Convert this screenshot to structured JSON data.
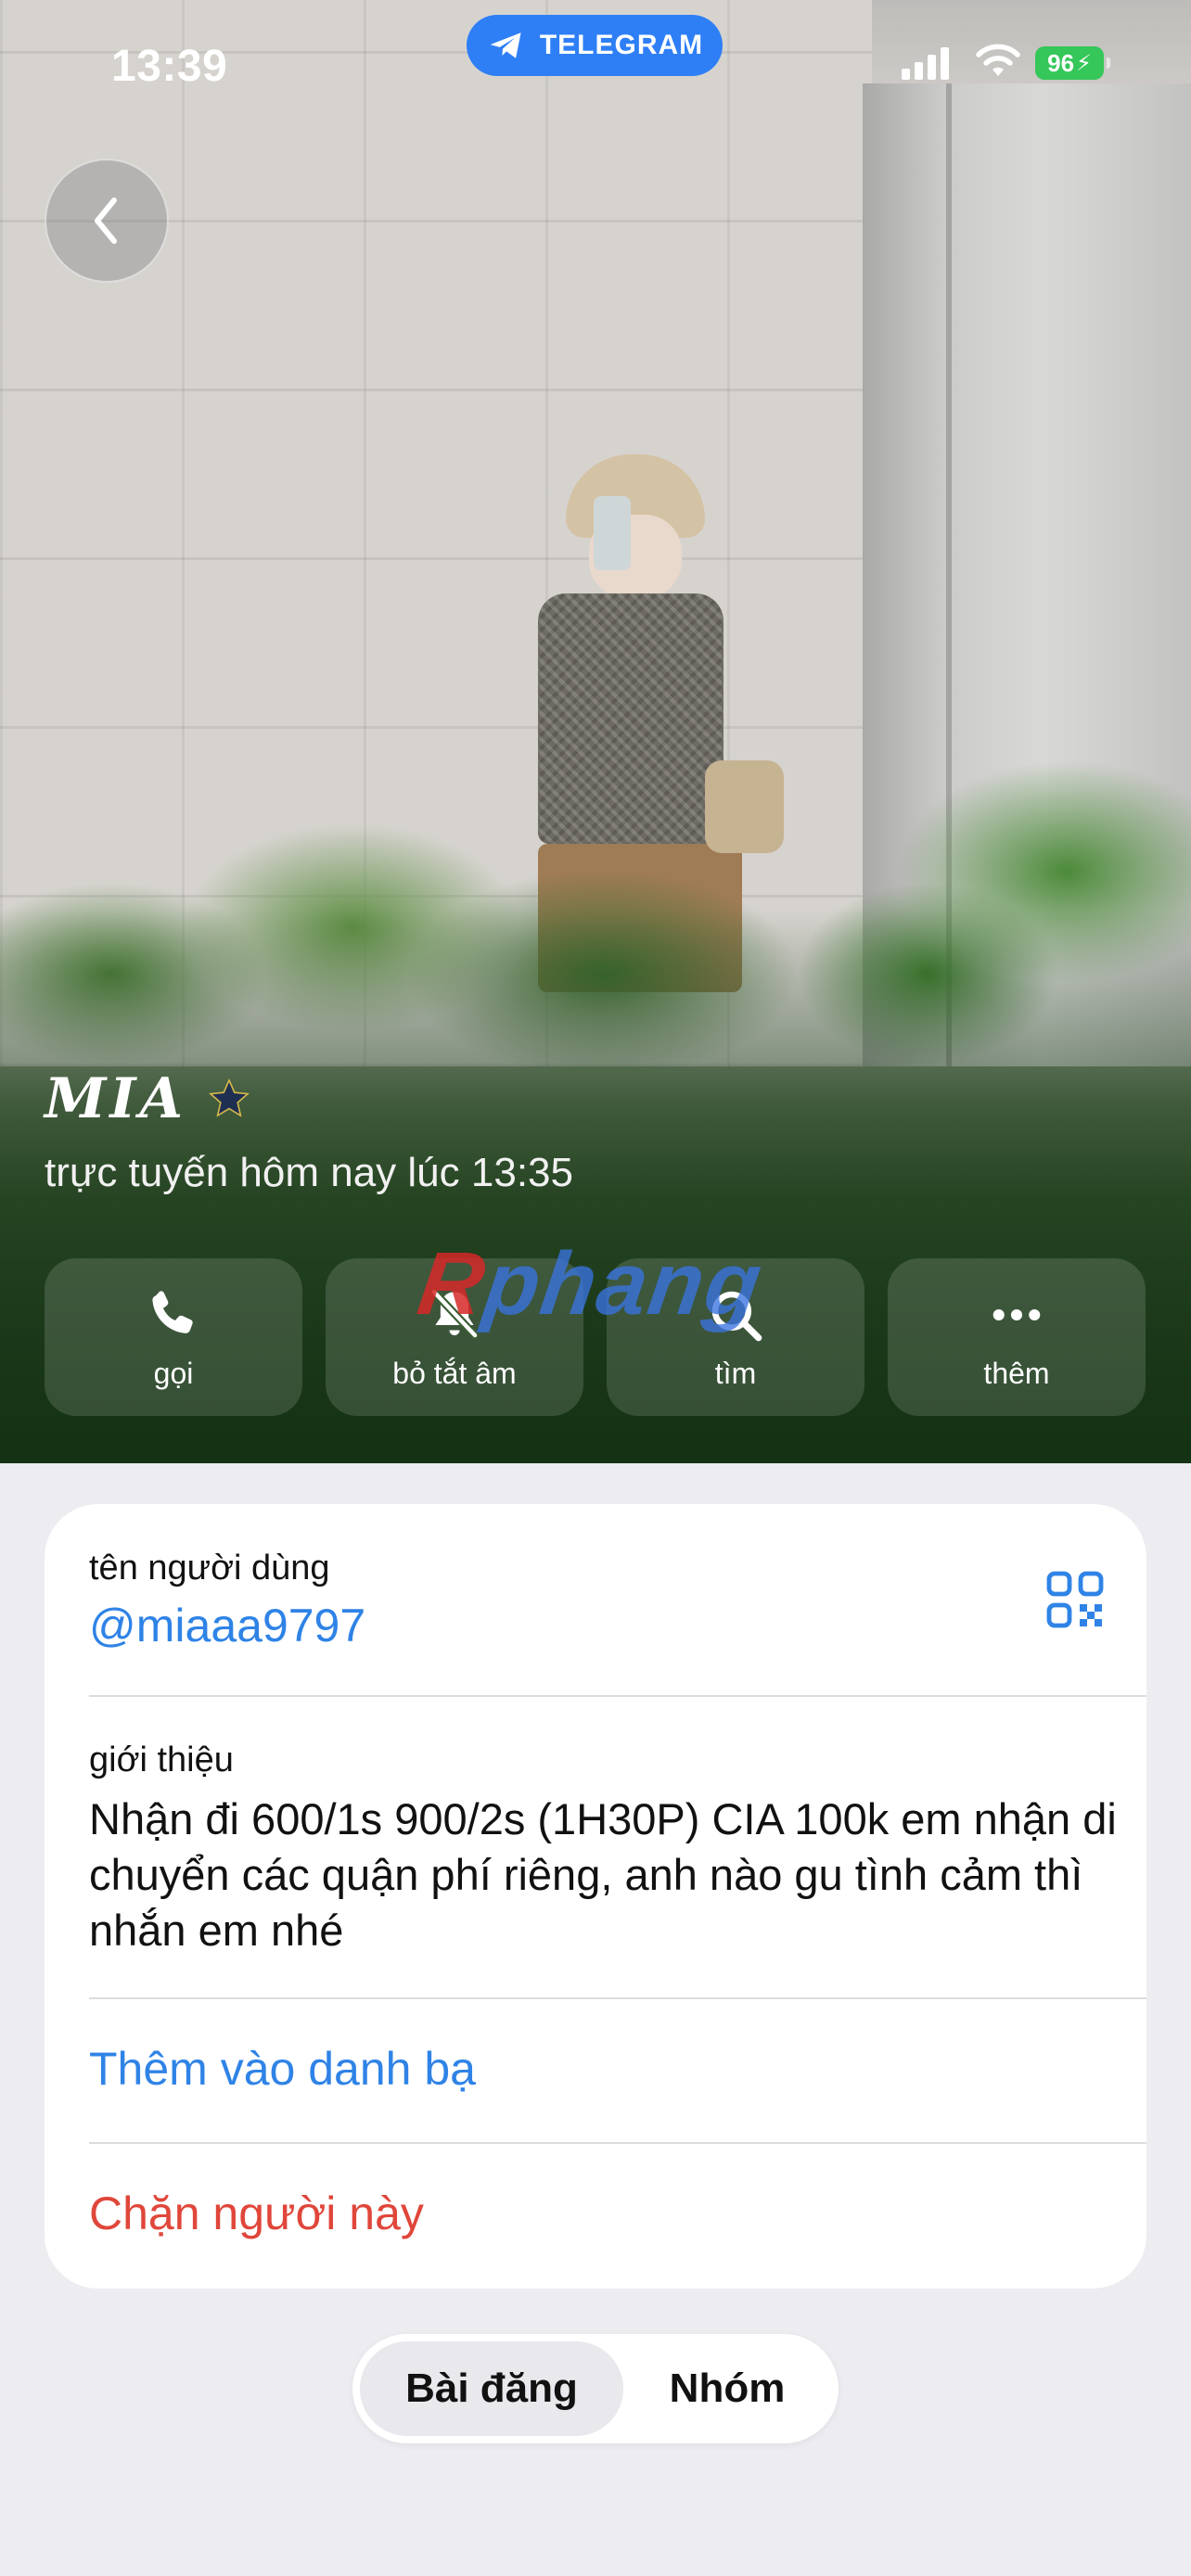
{
  "status_bar": {
    "time": "13:39",
    "app_pill": "TELEGRAM",
    "battery": "96"
  },
  "profile": {
    "name": "MIA",
    "last_seen": "trực tuyến hôm nay lúc 13:35"
  },
  "actions": [
    {
      "label": "gọi",
      "icon": "phone-icon"
    },
    {
      "label": "bỏ tắt âm",
      "icon": "bell-slash-icon"
    },
    {
      "label": "tìm",
      "icon": "search-icon"
    },
    {
      "label": "thêm",
      "icon": "more-icon"
    }
  ],
  "watermark": {
    "first": "R",
    "rest": "phang"
  },
  "info": {
    "username_label": "tên người dùng",
    "username": "@miaaa9797",
    "bio_label": "giới thiệu",
    "bio": "Nhận đi 600/1s 900/2s (1H30P) CIA 100k em nhận di chuyển các quận phí riêng, anh nào gu tình cảm thì nhắn em nhé",
    "add_contact": "Thêm vào danh bạ",
    "block": "Chặn người này"
  },
  "tabs": [
    {
      "label": "Bài đăng",
      "active": true
    },
    {
      "label": "Nhóm",
      "active": false
    }
  ],
  "colors": {
    "link": "#2f83e6",
    "danger": "#e0463a",
    "telegram": "#2e7ff6",
    "battery": "#35c759"
  }
}
